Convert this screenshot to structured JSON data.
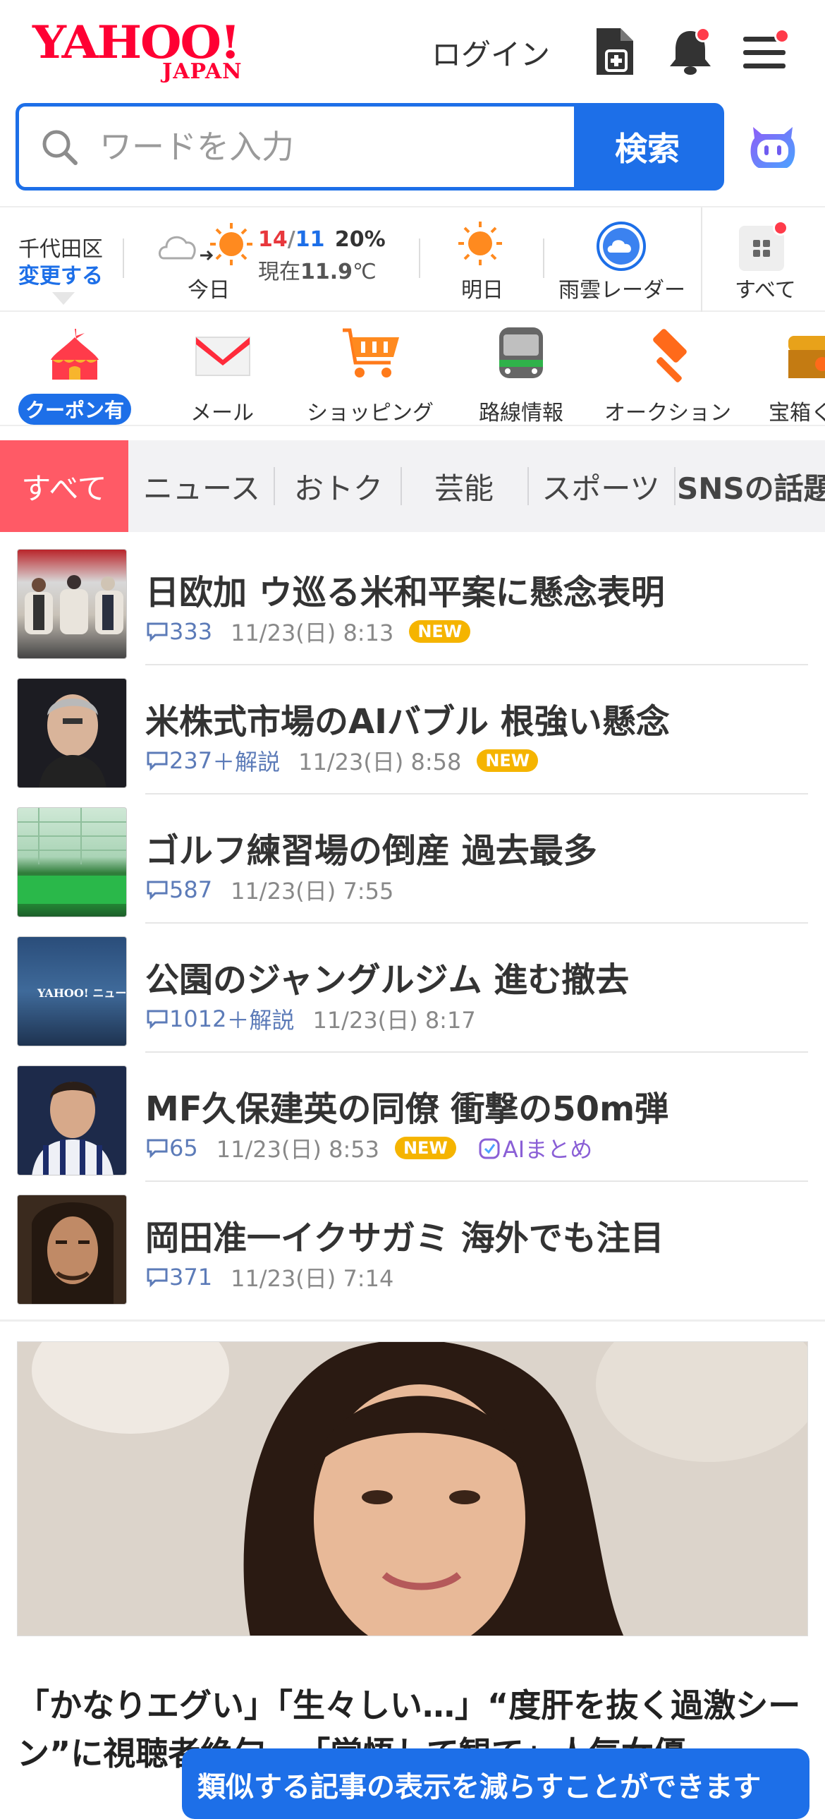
{
  "header": {
    "logo_main": "YAHOO!",
    "logo_sub": "JAPAN",
    "login": "ログイン"
  },
  "search": {
    "placeholder": "ワードを入力",
    "button": "検索"
  },
  "weather": {
    "area": "千代田区",
    "change": "変更する",
    "high": "14",
    "slash": "/",
    "low": "11",
    "rain": "20%",
    "current_prefix": "現在",
    "current_temp": "11.9",
    "current_unit": "℃",
    "today": "今日",
    "tomorrow": "明日",
    "radar": "雨雲レーダー",
    "all": "すべて"
  },
  "services": [
    {
      "label": "クーポン有"
    },
    {
      "label": "メール"
    },
    {
      "label": "ショッピング"
    },
    {
      "label": "路線情報"
    },
    {
      "label": "オークション"
    },
    {
      "label": "宝箱く"
    }
  ],
  "tabs": [
    {
      "label": "すべて"
    },
    {
      "label": "ニュース"
    },
    {
      "label": "おトク"
    },
    {
      "label": "芸能"
    },
    {
      "label": "スポーツ"
    },
    {
      "label": "SNSの話題"
    }
  ],
  "news": [
    {
      "title": "日欧加 ウ巡る米和平案に懸念表明",
      "comments": "333",
      "explain": "",
      "time": "11/23(日) 8:13",
      "new": "NEW",
      "ai": ""
    },
    {
      "title": "米株式市場のAIバブル 根強い懸念",
      "comments": "237",
      "explain": "＋解説",
      "time": "11/23(日) 8:58",
      "new": "NEW",
      "ai": ""
    },
    {
      "title": "ゴルフ練習場の倒産 過去最多",
      "comments": "587",
      "explain": "",
      "time": "11/23(日) 7:55",
      "new": "",
      "ai": ""
    },
    {
      "title": "公園のジャングルジム 進む撤去",
      "comments": "1012",
      "explain": "＋解説",
      "time": "11/23(日) 8:17",
      "new": "",
      "ai": ""
    },
    {
      "title": "MF久保建英の同僚 衝撃の50m弾",
      "comments": "65",
      "explain": "",
      "time": "11/23(日) 8:53",
      "new": "NEW",
      "ai": "AIまとめ"
    },
    {
      "title": "岡田准一イクサガミ 海外でも注目",
      "comments": "371",
      "explain": "",
      "time": "11/23(日) 7:14",
      "new": "",
      "ai": ""
    }
  ],
  "thumb_caption": "YAHOO! ニュース",
  "feature": {
    "title": "「かなりエグい」「生々しい…」“度肝を抜く過激シーン”に視聴者絶句…「覚悟して観て」人気女優"
  },
  "toast": "類似する記事の表示を減らすことができます"
}
